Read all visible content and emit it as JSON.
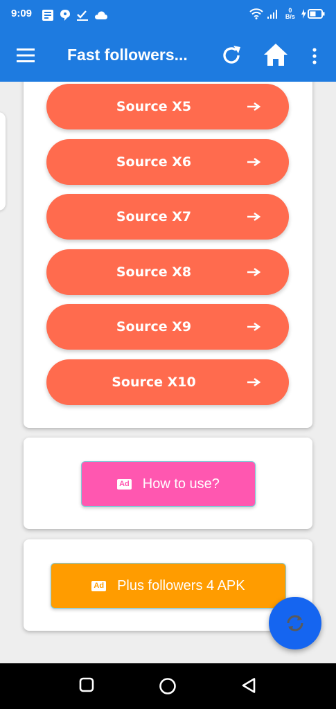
{
  "status_bar": {
    "time": "9:09",
    "net_speed_value": "0",
    "net_speed_unit": "B/s"
  },
  "app_bar": {
    "title": "Fast followers...",
    "icons": [
      "menu-icon",
      "refresh-icon",
      "home-icon",
      "more-vert-icon"
    ]
  },
  "sources": [
    {
      "label": "Source X5"
    },
    {
      "label": "Source X6"
    },
    {
      "label": "Source X7"
    },
    {
      "label": "Source X8"
    },
    {
      "label": "Source X9"
    },
    {
      "label": "Source X10"
    }
  ],
  "ad_buttons": {
    "howto": {
      "badge": "Ad",
      "label": "How to use?"
    },
    "apk": {
      "badge": "Ad",
      "label": "Plus followers 4 APK"
    }
  },
  "colors": {
    "primary": "#1e7be0",
    "source_button": "#ff6b4e",
    "howto_button": "#ff57b0",
    "apk_button": "#ff9c00",
    "fab": "#1565f0"
  }
}
